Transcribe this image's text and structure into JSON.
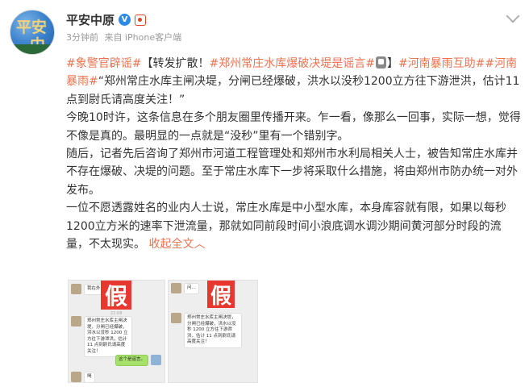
{
  "account": {
    "avatar_chars": [
      "平安",
      "中原"
    ],
    "username": "平安中原",
    "verified_symbol": "V"
  },
  "meta": {
    "time": "3分钟前",
    "source": "来自 iPhone客户端"
  },
  "post": {
    "tag_rumor": "#象警官辟谣#",
    "prefix": "【转发扩散！",
    "tag_title": "#郑州常庄水库爆破决堤是谣言#",
    "bracket_close": "】",
    "tag_rain_help": "#河南暴雨互助#",
    "tag_rain": "#河南暴雨#",
    "quote": "“郑州常庄水库主闸决堤，分闸已经爆破，洪水以没秒1200立方往下游泄洪，估计11点到尉氏请高度关注！”",
    "p1": "今晚10时许，这条信息在多个朋友圈里传播开来。乍一看，像那么一回事，实际一想，觉得不像是真的。最明显的一点就是“没秒”里有一个错别字。",
    "p2": "随后，记者先后咨询了郑州市河道工程管理处和郑州市水利局相关人士，被告知常庄水库并不存在爆破、决堤的问题。至于常庄水库下一步将采取什么措施，将由郑州市防办统一对外发布。",
    "p3": "一位不愿透露姓名的业内人士说，常庄水库是中小型水库，本身库容就有限，如果以每秒1200立方米的速率下泄流量，那就如同前段时间小浪底调水调沙期间黄河部分时段的流量，不太现实。",
    "collapse_label": "收起全文",
    "collapse_arrow": "︿"
  },
  "images": {
    "fake_label": "假",
    "img1": {
      "top_bubble": "我在外",
      "time": "22:08",
      "message": "郑州常庄水库主闸决堤，分闸已经爆破，洪水以没秒 1200 立方往下游泄洪，估计 11 点到尉氏请高度关注！",
      "reply": "这个是谣言。",
      "bottom_bubble": "喝"
    },
    "img2": {
      "top_bubble": "问...",
      "message": "郑州常庄水库主闸决堤，分闸已经爆破，洪水以没秒 1200 立方往下游泄洪，估计 11 点到尉氏请高度关注！"
    }
  }
}
